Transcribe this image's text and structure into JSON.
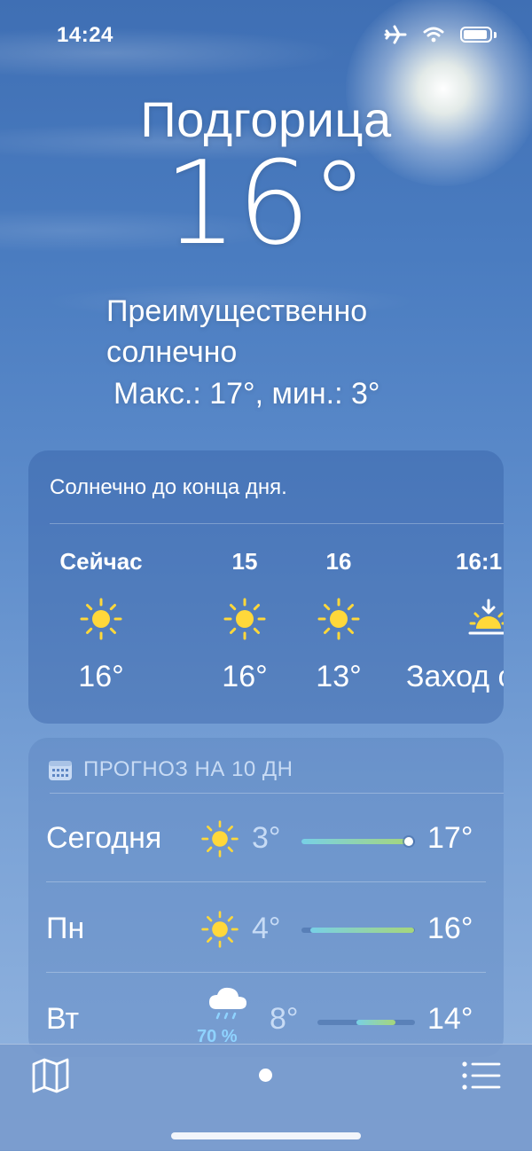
{
  "status_bar": {
    "time": "14:24"
  },
  "location": {
    "city": "Подгорица"
  },
  "current": {
    "temperature": "16°",
    "condition": "Преимущественно солнечно",
    "hi_lo": "Макс.: 17°, мин.: 3°"
  },
  "hourly": {
    "summary": "Солнечно до конца дня.",
    "items": [
      {
        "label": "Сейчас",
        "icon": "sun-icon",
        "value": "16°"
      },
      {
        "label": "15",
        "icon": "sun-icon",
        "value": "16°"
      },
      {
        "label": "16",
        "icon": "sun-icon",
        "value": "13°"
      },
      {
        "label": "16:1",
        "icon": "sunset-icon",
        "value": "Заход с"
      }
    ]
  },
  "daily": {
    "header": "ПРОГНОЗ НА 10 ДН",
    "days": [
      {
        "name": "Сегодня",
        "icon": "sun-icon",
        "low": "3°",
        "high": "17°",
        "range_start": 0.0,
        "range_end": 0.97,
        "current_marker": true
      },
      {
        "name": "Пн",
        "icon": "sun-icon",
        "low": "4°",
        "high": "16°",
        "range_start": 0.08,
        "range_end": 0.99
      },
      {
        "name": "Вт",
        "icon": "cloud-rain-icon",
        "precip": "70 %",
        "low": "8°",
        "high": "14°",
        "range_start": 0.4,
        "range_end": 0.8
      }
    ]
  },
  "tabs": {
    "map": "map-icon",
    "list": "list-icon"
  },
  "colors": {
    "sun": "#ffd83a",
    "range_start": "#78d0e6",
    "range_end": "#a6d67a",
    "precip": "#8fd3ff"
  }
}
